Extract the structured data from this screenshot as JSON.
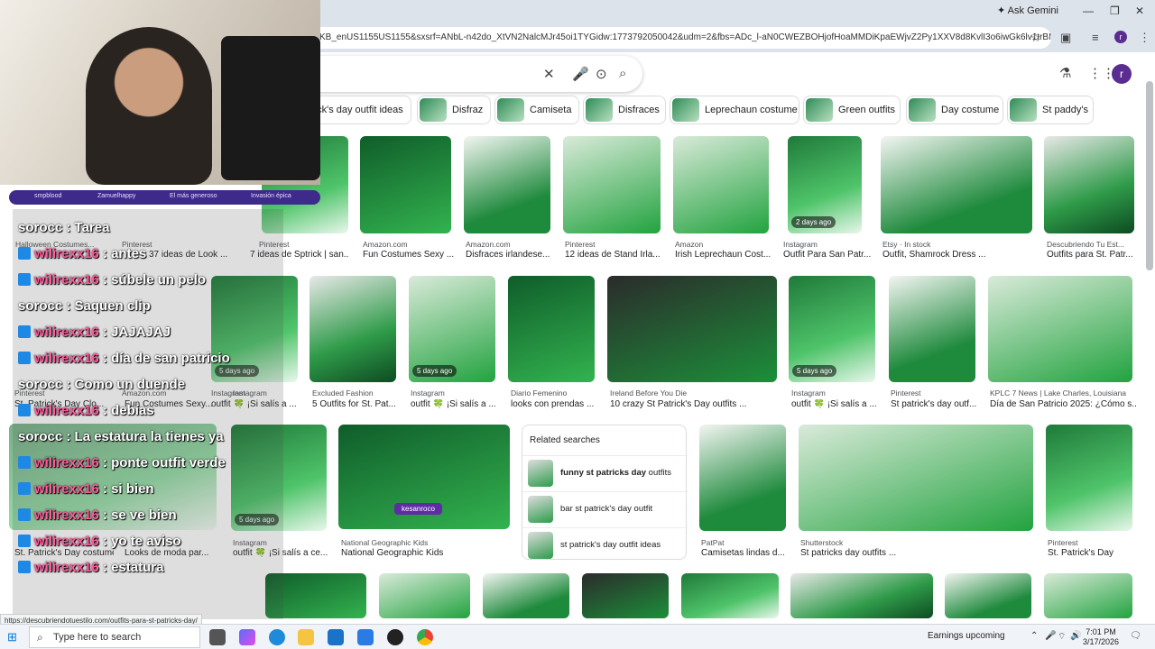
{
  "browser": {
    "url": "KB_enUS1155US1155&sxsrf=ANbL-n42do_XtVN2NalcMJr45oi1TYGidw:1773792050042&udm=2&fbs=ADc_l-aN0CWEZBOHjofHoaMMDiKpaEWjvZ2Py1XXV8d8KvlI3o6iwGk6lv1trBNIZlBNIVs--",
    "ask_label": "Ask Gemini",
    "profile_initial": "r"
  },
  "search": {
    "profile_initial": "r"
  },
  "chips": [
    "rick's day outfit ideas",
    "Disfraz",
    "Camiseta",
    "Disfraces",
    "Leprechaun costume",
    "Green outfits",
    "Day costume",
    "St paddy's"
  ],
  "row1": [
    {
      "src": "Pinterest",
      "cap": "7 ideas de Sptrick | san..."
    },
    {
      "src": "Amazon.com",
      "cap": "Fun Costumes Sexy ..."
    },
    {
      "src": "Amazon.com",
      "cap": "Disfraces irlandese..."
    },
    {
      "src": "Pinterest",
      "cap": "12 ideas de Stand Irla..."
    },
    {
      "src": "Amazon",
      "cap": "Irish Leprechaun Cost..."
    },
    {
      "src": "Instagram",
      "cap": "Outfit Para San Patr...",
      "age": "2 days ago"
    },
    {
      "src": "Etsy · In stock",
      "cap": "Outfit, Shamrock Dress ..."
    },
    {
      "src": "Descubriendo Tu Est...",
      "cap": "Outfits para St. Patr..."
    }
  ],
  "row2": [
    {
      "src": "Instagram",
      "cap": "outfit 🍀 ¡Si salís a ...",
      "age": "5 days ago"
    },
    {
      "src": "Excluded Fashion",
      "cap": "5 Outfits for St. Pat..."
    },
    {
      "src": "Instagram",
      "cap": "outfit 🍀 ¡Si salís a ...",
      "age": "5 days ago"
    },
    {
      "src": "Diario Femenino",
      "cap": "looks con prendas ..."
    },
    {
      "src": "Ireland Before You Die",
      "cap": "10 crazy St Patrick's Day outfits ..."
    },
    {
      "src": "Instagram",
      "cap": "outfit 🍀 ¡Si salís a ...",
      "age": "5 days ago"
    },
    {
      "src": "Pinterest",
      "cap": "St patrick's day outf..."
    },
    {
      "src": "KPLC 7 News | Lake Charles, Louisiana",
      "cap": "Día de San Patricio 2025: ¿Cómo s..."
    }
  ],
  "row3": [
    {
      "src": "Instagram",
      "cap": "outfit 🍀 ¡Si salís a ce...",
      "age": "5 days ago"
    },
    {
      "src": "National Geographic Kids",
      "cap": "National Geographic Kids",
      "badge": "kesanroco"
    },
    {
      "src": "PatPat",
      "cap": "Camisetas lindas d..."
    },
    {
      "src": "Shutterstock",
      "cap": "St patricks day outfits ..."
    },
    {
      "src": "Pinterest",
      "cap": "St. Patrick's Day"
    }
  ],
  "related": {
    "title": "Related searches",
    "items": [
      {
        "bold": "funny st patricks day",
        "rest": " outfits"
      },
      {
        "bold": "",
        "rest": "bar st patrick's day outfit"
      },
      {
        "bold": "",
        "rest": "st patrick's day outfit ideas"
      }
    ]
  },
  "overlay_left": {
    "srcs": [
      "Halloween Costumes...",
      "Pinterest",
      "Pinterest",
      "Amazon.com",
      "Instagram"
    ],
    "caps": [
      "37 ideas de Look ...",
      "St. Patrick's Day Clo...",
      "Fun Costumes Sexy...",
      "St. Patrick's Day costume",
      "Looks de moda par..."
    ]
  },
  "stream": {
    "subs": [
      "smpblood",
      "Zamuelhappy",
      "El más generoso",
      "Invasión épica"
    ],
    "chat": [
      {
        "user": "sorocc",
        "msg": "Tarea"
      },
      {
        "user": "wilirexx16",
        "msg": "antes"
      },
      {
        "user": "wilirexx16",
        "msg": "súbele un pelo"
      },
      {
        "user": "sorocc",
        "msg": "Saquen clip"
      },
      {
        "user": "wilirexx16",
        "msg": "JAJAJAJ"
      },
      {
        "user": "wilirexx16",
        "msg": "día de san patricio"
      },
      {
        "user": "sorocc",
        "msg": "Como un duende"
      },
      {
        "user": "wilirexx16",
        "msg": "debías"
      },
      {
        "user": "sorocc",
        "msg": "La estatura la tienes ya"
      },
      {
        "user": "wilirexx16",
        "msg": "ponte outfit verde"
      },
      {
        "user": "wilirexx16",
        "msg": "si bien"
      },
      {
        "user": "wilirexx16",
        "msg": "se ve bien"
      },
      {
        "user": "wilirexx16",
        "msg": "yo te aviso"
      },
      {
        "user": "wilirexx16",
        "msg": "estatura"
      }
    ]
  },
  "status_url": "https://descubriendotuestilo.com/outfits-para-st-patricks-day/",
  "taskbar": {
    "search_placeholder": "Type here to search",
    "news": "Earnings upcoming",
    "time": "7:01 PM",
    "date": "3/17/2026"
  }
}
